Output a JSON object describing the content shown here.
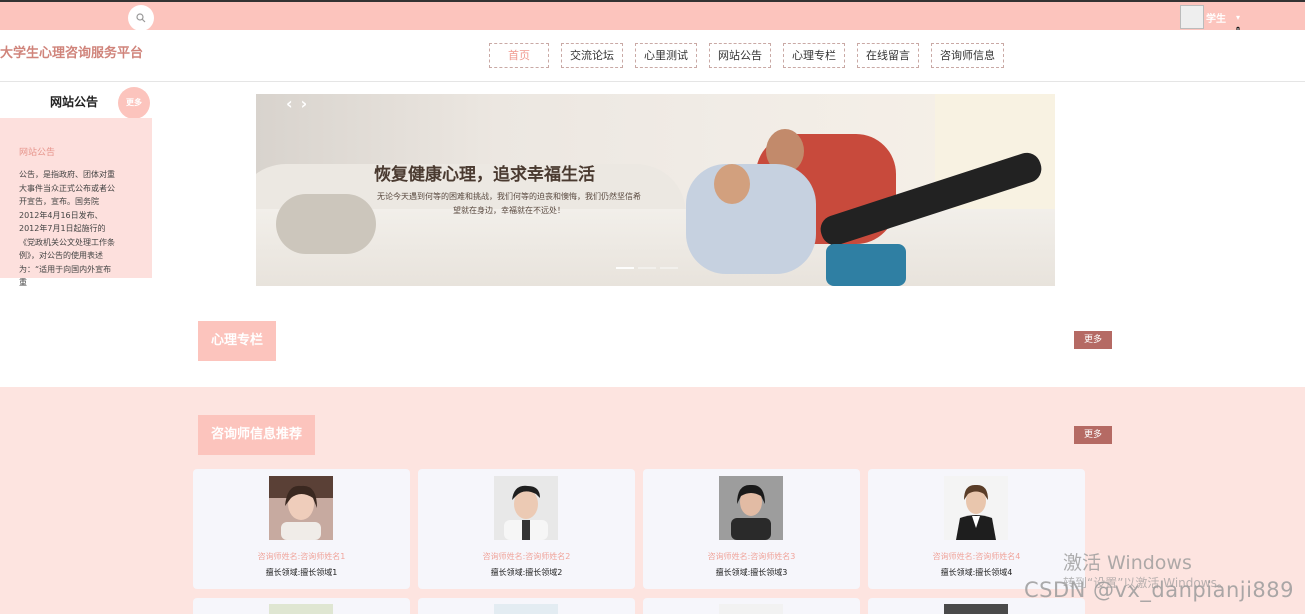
{
  "topbar": {
    "search_icon": "search-icon",
    "user": {
      "name": "学生",
      "caret": "▾"
    },
    "colors": {
      "topbar_bg": "#fcc4bd",
      "accent": "#b56a64"
    }
  },
  "header": {
    "site_title": "大学生心理咨询服务平台",
    "nav": [
      "首页",
      "交流论坛",
      "心里测试",
      "网站公告",
      "心理专栏",
      "在线留言",
      "咨询师信息"
    ]
  },
  "notice": {
    "title": "网站公告",
    "more": "更多",
    "subtitle": "网站公告",
    "text": "公告，是指政府、团体对重大事件当众正式公布或者公开宣告，宣布。国务院2012年4月16日发布、2012年7月1日起施行的《党政机关公文处理工作条例》，对公告的使用表述为：“适用于向国内外宣布重"
  },
  "banner": {
    "heading": "恢复健康心理，追求幸福生活",
    "subtext": "无论今天遇到何等的困难和挑战，我们何等的迫丧和懊悔，我们仍然坚信希望就在身边，幸福就在不远处！",
    "prev": "‹",
    "next": "›"
  },
  "sections": {
    "column": {
      "title": "心理专栏",
      "more": "更多"
    },
    "counselors": {
      "title": "咨询师信息推荐",
      "more": "更多"
    }
  },
  "counselors": [
    {
      "name": "咨询师姓名:咨询师姓名1",
      "field": "擅长领域:擅长领域1"
    },
    {
      "name": "咨询师姓名:咨询师姓名2",
      "field": "擅长领域:擅长领域2"
    },
    {
      "name": "咨询师姓名:咨询师姓名3",
      "field": "擅长领域:擅长领域3"
    },
    {
      "name": "咨询师姓名:咨询师姓名4",
      "field": "擅长领域:擅长领域4"
    }
  ],
  "watermark": {
    "activate": "激活 Windows",
    "activate_hint": "转到“设置”以激活 Windows。",
    "csdn": "CSDN @vx_danpianji889"
  }
}
